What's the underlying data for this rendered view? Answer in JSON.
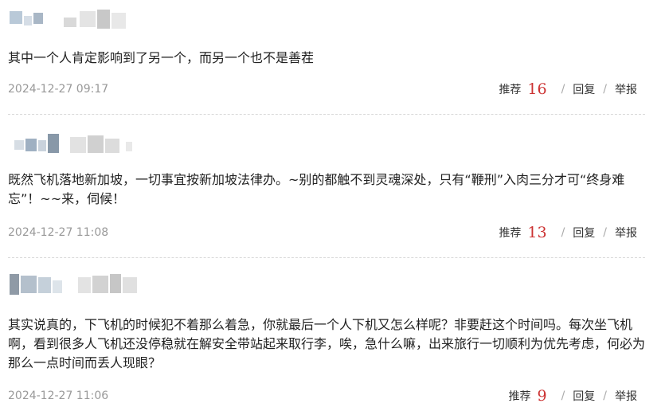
{
  "accent_color": "#cc3333",
  "comments": [
    {
      "content": "其中一个人肯定影响到了另一个，而另一个也不是善茬",
      "time": "2024-12-27 09:17",
      "like_label": "推荐",
      "like_count": "16",
      "reply_label": "回复",
      "report_label": "举报",
      "separator": "/"
    },
    {
      "content": "既然飞机落地新加坡，一切事宜按新加坡法律办。~别的都触不到灵魂深处，只有“鞭刑”入肉三分才可“终身难忘”！~~来，伺候！",
      "time": "2024-12-27 11:08",
      "like_label": "推荐",
      "like_count": "13",
      "reply_label": "回复",
      "report_label": "举报",
      "separator": "/"
    },
    {
      "content": "其实说真的，下飞机的时候犯不着那么着急，你就最后一个人下机又怎么样呢？非要赶这个时间吗。每次坐飞机啊，看到很多人飞机还没停稳就在解安全带站起来取行李，唉，急什么嘛，出来旅行一切顺利为优先考虑，何必为那么一点时间而丢人现眼？",
      "time": "2024-12-27 11:06",
      "like_label": "推荐",
      "like_count": "9",
      "reply_label": "回复",
      "report_label": "举报",
      "separator": "/"
    }
  ]
}
